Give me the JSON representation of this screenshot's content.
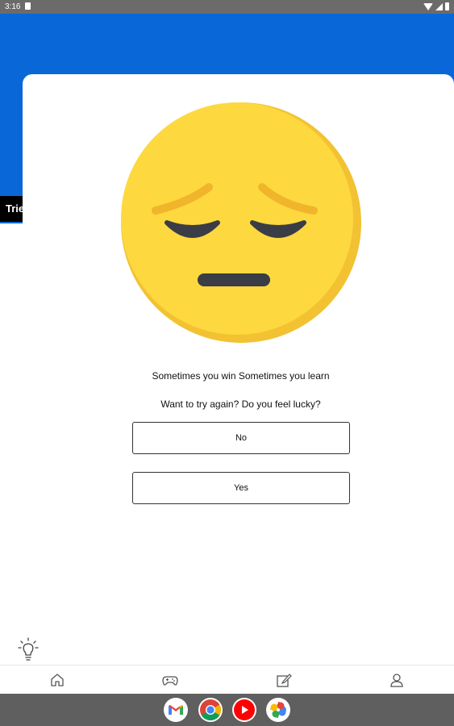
{
  "status_bar": {
    "time": "3:16"
  },
  "background_screen": {
    "label": "Trie"
  },
  "dialog": {
    "message_line1": "Sometimes you win Sometimes you learn",
    "message_line2": "Want to try again? Do you feel lucky?",
    "no_label": "No",
    "yes_label": "Yes",
    "emoji": "pensive-face-icon"
  },
  "bottom_nav": {
    "items": [
      "home-icon",
      "gamepad-icon",
      "edit-icon",
      "profile-icon"
    ]
  },
  "taskbar": {
    "apps": [
      "gmail-icon",
      "chrome-icon",
      "youtube-icon",
      "photos-icon"
    ]
  },
  "colors": {
    "header_blue": "#0a67d8",
    "emoji_yellow": "#fdd83f",
    "emoji_shadow": "#f2c232"
  }
}
